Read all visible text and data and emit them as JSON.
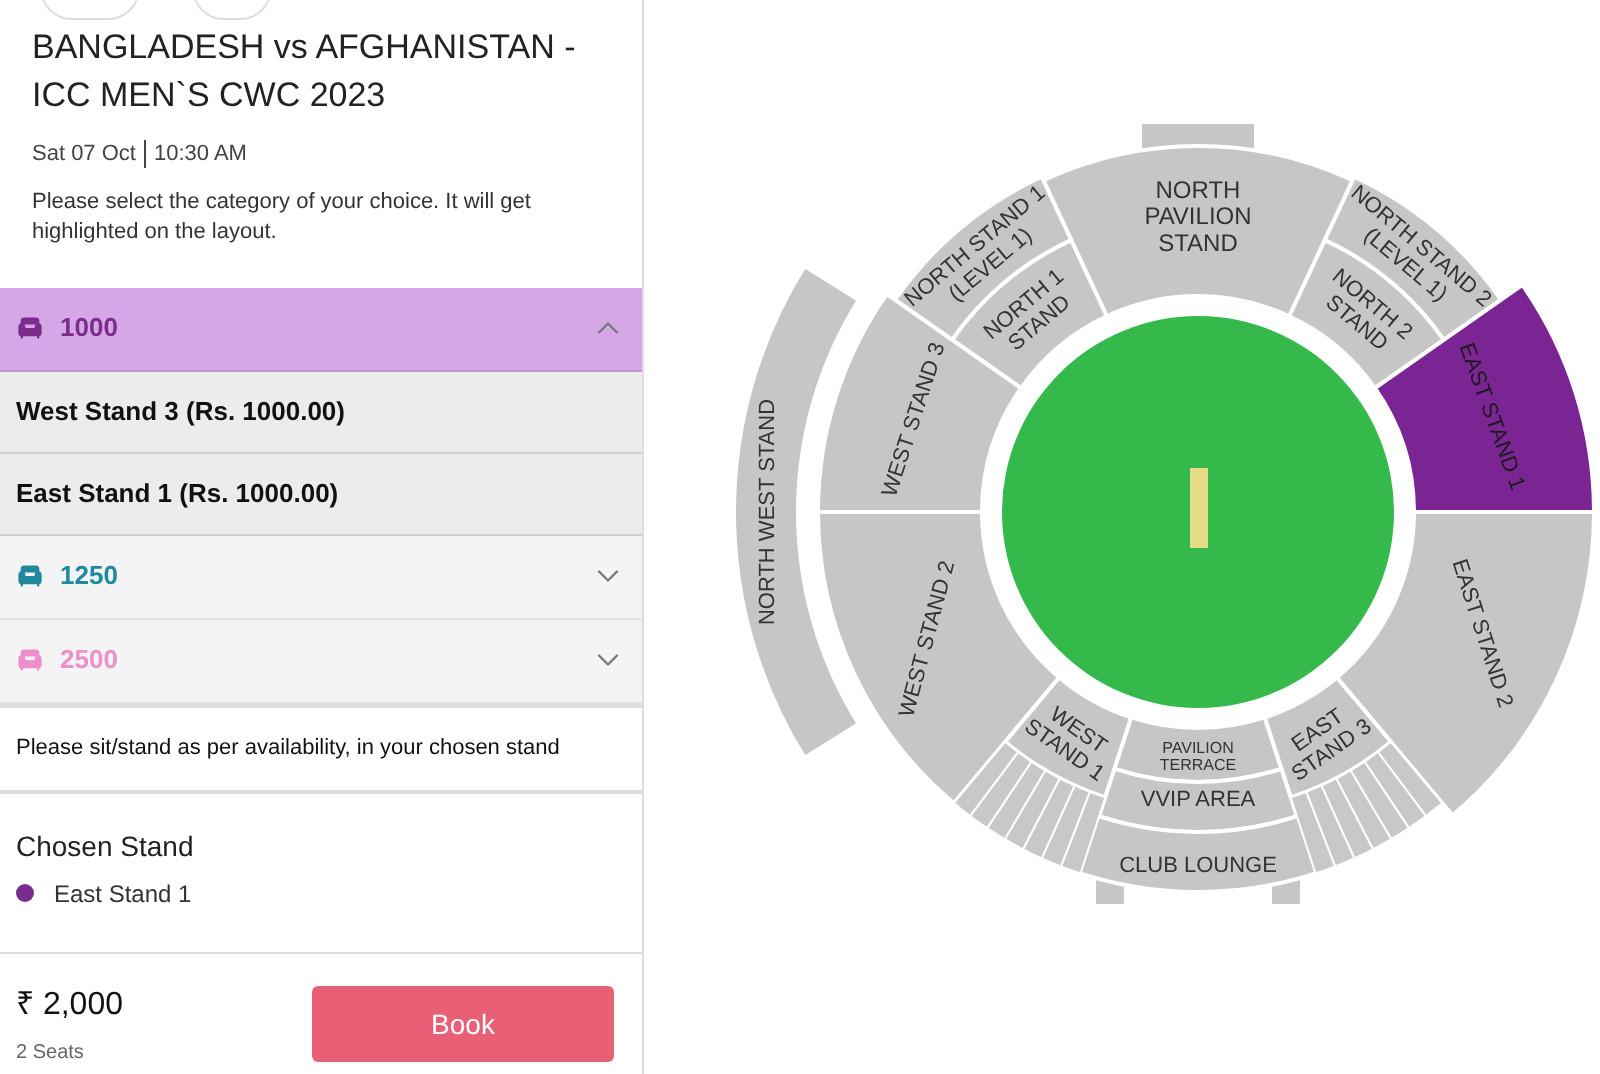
{
  "event": {
    "title": "BANGLADESH vs AFGHANISTAN - ICC MEN`S CWC 2023",
    "date": "Sat 07 Oct",
    "time": "10:30 AM",
    "instruction": "Please select the category of your choice. It will get highlighted on the layout."
  },
  "categories": [
    {
      "label": "1000",
      "color": "#7b2d8e",
      "expanded": true,
      "selected": true,
      "stands": [
        "West Stand 3 (Rs. 1000.00)",
        "East Stand 1 (Rs. 1000.00)"
      ]
    },
    {
      "label": "1250",
      "color": "#1f8a9e",
      "expanded": false,
      "selected": false
    },
    {
      "label": "2500",
      "color": "#ec8fcb",
      "expanded": false,
      "selected": false
    }
  ],
  "note": "Please sit/stand as per availability, in your chosen stand",
  "chosen": {
    "heading": "Chosen Stand",
    "stand": "East Stand 1",
    "color": "#7b2d8e"
  },
  "footer": {
    "price": "₹ 2,000",
    "seats": "2 Seats",
    "button": "Book"
  },
  "map": {
    "stands": [
      {
        "lines": [
          "NORTH",
          "PAVILION",
          "STAND"
        ],
        "selected": false
      },
      {
        "lines": [
          "NORTH STAND 1",
          "(LEVEL 1)"
        ],
        "selected": false
      },
      {
        "lines": [
          "NORTH 1",
          "STAND"
        ],
        "selected": false
      },
      {
        "lines": [
          "NORTH STAND 2",
          "(LEVEL 1)"
        ],
        "selected": false
      },
      {
        "lines": [
          "NORTH 2",
          "STAND"
        ],
        "selected": false
      },
      {
        "lines": [
          "WEST STAND 3"
        ],
        "selected": false
      },
      {
        "lines": [
          "EAST STAND 1"
        ],
        "selected": true
      },
      {
        "lines": [
          "NORTH WEST STAND"
        ],
        "selected": false
      },
      {
        "lines": [
          "WEST STAND 2"
        ],
        "selected": false
      },
      {
        "lines": [
          "EAST STAND 2"
        ],
        "selected": false
      },
      {
        "lines": [
          "WEST",
          "STAND 1"
        ],
        "selected": false
      },
      {
        "lines": [
          "PAVILION",
          "TERRACE"
        ],
        "selected": false
      },
      {
        "lines": [
          "EAST",
          "STAND 3"
        ],
        "selected": false
      },
      {
        "lines": [
          "VVIP AREA"
        ],
        "selected": false
      },
      {
        "lines": [
          "CLUB LOUNGE"
        ],
        "selected": false
      }
    ]
  }
}
